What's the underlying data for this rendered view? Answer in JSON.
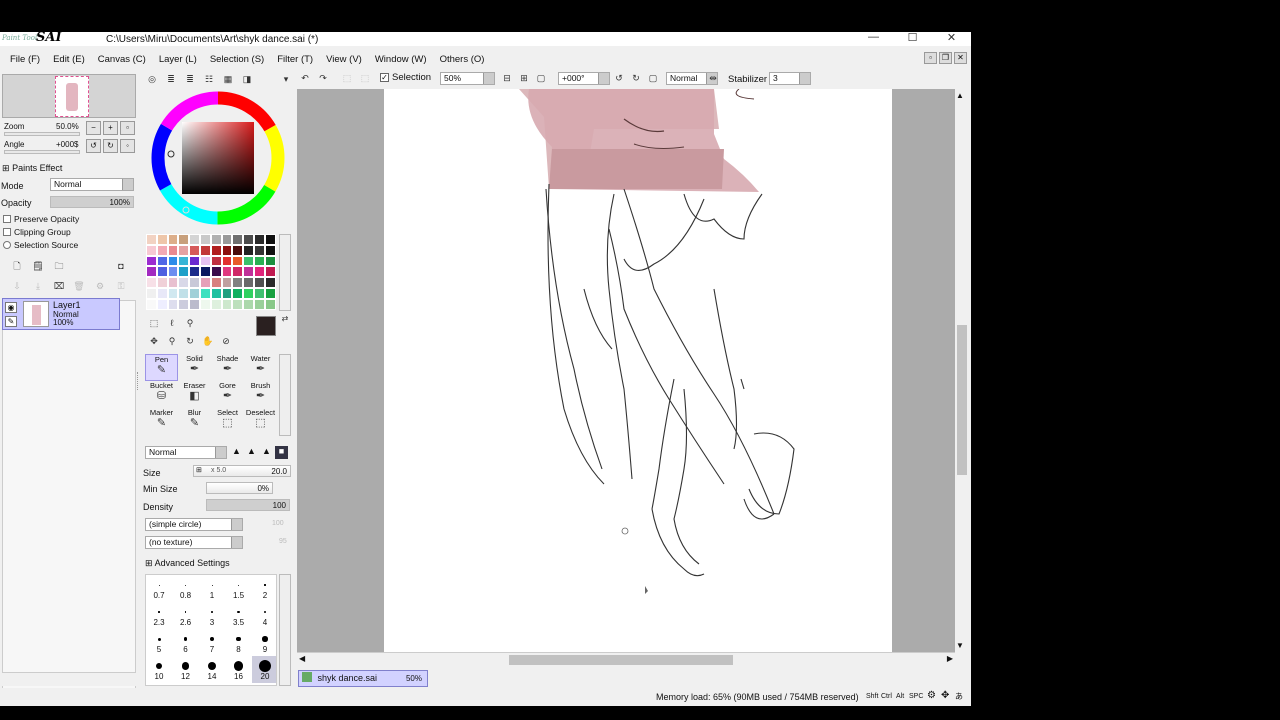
{
  "window": {
    "logo_script": "Paint Tool",
    "logo_bold": "SAI",
    "title": "C:\\Users\\Miru\\Documents\\Art\\shyk dance.sai (*)",
    "controls": [
      "—",
      "☐",
      "✕"
    ]
  },
  "menu": [
    "File (F)",
    "Edit (E)",
    "Canvas (C)",
    "Layer (L)",
    "Selection (S)",
    "Filter (T)",
    "View (V)",
    "Window (W)",
    "Others (O)"
  ],
  "navigator": {
    "zoom_label": "Zoom",
    "zoom_value": "50.0%",
    "angle_label": "Angle",
    "angle_value": "+000$"
  },
  "paints_effect": {
    "header": "Paints Effect",
    "mode_label": "Mode",
    "mode_value": "Normal",
    "opacity_label": "Opacity",
    "opacity_value": "100%",
    "opacity_fraction": 1.0,
    "preserve_opacity": "Preserve Opacity",
    "clipping_group": "Clipping Group",
    "selection_source": "Selection Source"
  },
  "layer": {
    "name": "Layer1",
    "mode": "Normal",
    "opacity": "100%"
  },
  "swatches": [
    "#f2d2c2",
    "#eec6a9",
    "#dcae8a",
    "#c8a07c",
    "#d4d4d4",
    "#c9c9c9",
    "#b0b0b0",
    "#999",
    "#6f6f6f",
    "#4c4c4c",
    "#2a2a2a",
    "#101010",
    "#f7c9d3",
    "#f3aab5",
    "#e98a90",
    "#e4a2a2",
    "#d65a5a",
    "#c23838",
    "#b11e1e",
    "#8c1010",
    "#4a0c0c",
    "#222",
    "#333",
    "#111",
    "#9b2cd0",
    "#4f68e6",
    "#2d8de9",
    "#38b5d6",
    "#6a2ad0",
    "#e6c2f0",
    "#c03040",
    "#e13030",
    "#e85a2a",
    "#3ac06a",
    "#2ab052",
    "#1d8f3e",
    "#a22ac0",
    "#4f5fe0",
    "#6e8ef0",
    "#1fa0c8",
    "#1a2a8a",
    "#0b1860",
    "#3b0b4b",
    "#e03880",
    "#d02868",
    "#c03098",
    "#e0247a",
    "#c01a50",
    "#f7e0e7",
    "#f0d0d8",
    "#e8c0d0",
    "#d8d8e8",
    "#c8c8d8",
    "#e6a0b8",
    "#d88080",
    "#c0a0a0",
    "#808080",
    "#6a6a6a",
    "#505050",
    "#2a2a2a",
    "#f0f0f0",
    "#e8e8f8",
    "#d0e8f0",
    "#c0e0e8",
    "#a0d0d8",
    "#40e0c0",
    "#20c0a0",
    "#20a080",
    "#10b060",
    "#30d060",
    "#40c070",
    "#18a040",
    "#f9f9f9",
    "#eef",
    "#dde",
    "#ccd",
    "#bbc",
    "#eef8ee",
    "#def0de",
    "#cde8cd",
    "#bce0bc",
    "#abd8ab",
    "#9ad09a",
    "#89c889"
  ],
  "main_color": "#2a2020",
  "tools": [
    {
      "label": "Pen",
      "glyph": "✎",
      "active": true
    },
    {
      "label": "Solid",
      "glyph": "✒"
    },
    {
      "label": "Shade",
      "glyph": "✒"
    },
    {
      "label": "Water",
      "glyph": "✒"
    },
    {
      "label": "Bucket",
      "glyph": "⛁"
    },
    {
      "label": "Eraser",
      "glyph": "◧"
    },
    {
      "label": "Gore",
      "glyph": "✒"
    },
    {
      "label": "Brush",
      "glyph": "✒"
    },
    {
      "label": "Marker",
      "glyph": "✎"
    },
    {
      "label": "Blur",
      "glyph": "✎"
    },
    {
      "label": "Select",
      "glyph": "⬚"
    },
    {
      "label": "Deselect",
      "glyph": "⬚"
    }
  ],
  "brush": {
    "blend_mode": "Normal",
    "size_label": "Size",
    "size_multiplier": "x 5.0",
    "size_value": "20.0",
    "min_size_label": "Min Size",
    "min_size_value": "0%",
    "density_label": "Density",
    "density_value": "100",
    "density_fraction": 1.0,
    "shape": "(simple circle)",
    "shape_value": "100",
    "texture": "(no texture)",
    "texture_value": "95",
    "advanced": "Advanced Settings"
  },
  "brush_sizes": [
    "0.7",
    "0.8",
    "1",
    "1.5",
    "2",
    "2.3",
    "2.6",
    "3",
    "3.5",
    "4",
    "5",
    "6",
    "7",
    "8",
    "9",
    "10",
    "12",
    "14",
    "16",
    "20"
  ],
  "brush_sizes_active": "20",
  "toolbar": {
    "selection_label": "Selection",
    "zoom": "50%",
    "angle": "+000°",
    "blend": "Normal",
    "stabilizer_label": "Stabilizer",
    "stabilizer_value": "3"
  },
  "tab": {
    "filename": "shyk dance.sai",
    "zoom": "50%"
  },
  "status": {
    "memory": "Memory load: 65% (90MB used / 754MB reserved)",
    "keys": [
      "Shft",
      "Ctrl",
      "Alt",
      "SPC"
    ]
  },
  "colors": {
    "accent_layer": "#c9c9ff",
    "tab": "#d2d2ff",
    "canvas_bg": "#ababab"
  }
}
